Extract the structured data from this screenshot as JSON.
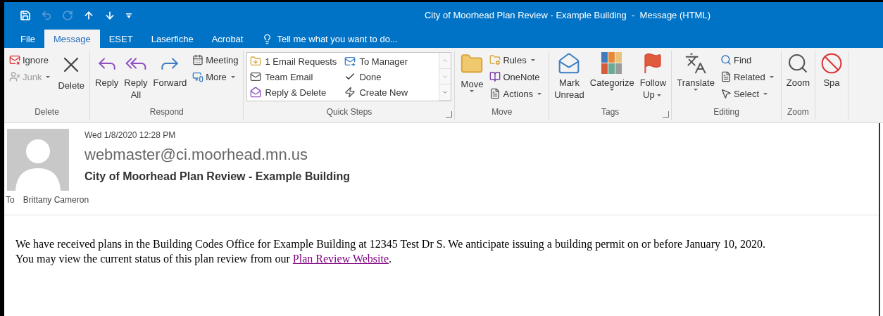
{
  "quick_access": [
    {
      "disabled": false
    },
    {
      "disabled": true
    },
    {
      "disabled": true
    },
    {
      "disabled": false
    },
    {
      "disabled": false
    },
    {
      "disabled": false
    }
  ],
  "window": {
    "title": "City of Moorhead Plan Review - Example Building  -  Message (HTML)"
  },
  "tabs": [
    {
      "label": "File",
      "selected": false
    },
    {
      "label": "Message",
      "selected": true
    },
    {
      "label": "ESET",
      "selected": false
    },
    {
      "label": "Laserfiche",
      "selected": false
    },
    {
      "label": "Acrobat",
      "selected": false
    }
  ],
  "tell_me": {
    "placeholder": "Tell me what you want to do..."
  },
  "ribbon": [
    {
      "label": "Delete",
      "launcher": false,
      "items": [
        {
          "kind": "stack",
          "items": [
            {
              "label": "Ignore",
              "dropdown": false,
              "disabled": false
            },
            {
              "label": "Junk",
              "dropdown": true,
              "disabled": true
            }
          ]
        },
        {
          "kind": "large",
          "label": "Delete",
          "dropdown": false
        }
      ]
    },
    {
      "label": "Respond",
      "launcher": false,
      "items": [
        {
          "kind": "large",
          "label": "Reply",
          "dropdown": false
        },
        {
          "kind": "large",
          "label": "Reply\nAll",
          "dropdown": false
        },
        {
          "kind": "large",
          "label": "Forward",
          "dropdown": false
        },
        {
          "kind": "stack",
          "items": [
            {
              "label": "Meeting",
              "dropdown": false,
              "disabled": false
            },
            {
              "label": "More",
              "dropdown": true,
              "disabled": false
            }
          ]
        }
      ]
    },
    {
      "label": "Quick Steps",
      "launcher": true,
      "items": [
        {
          "kind": "gallery",
          "items": [
            {
              "label": "1 Email Requests"
            },
            {
              "label": "To Manager"
            },
            {
              "label": "Team Email"
            },
            {
              "label": "Done"
            },
            {
              "label": "Reply & Delete"
            },
            {
              "label": "Create New"
            }
          ]
        }
      ]
    },
    {
      "label": "Move",
      "launcher": false,
      "items": [
        {
          "kind": "large",
          "label": "Move",
          "dropdown": true
        },
        {
          "kind": "stack",
          "items": [
            {
              "label": "Rules",
              "dropdown": true,
              "disabled": false
            },
            {
              "label": "OneNote",
              "dropdown": false,
              "disabled": false
            },
            {
              "label": "Actions",
              "dropdown": true,
              "disabled": false
            }
          ]
        }
      ]
    },
    {
      "label": "Tags",
      "launcher": true,
      "items": [
        {
          "kind": "large",
          "label": "Mark\nUnread",
          "dropdown": false
        },
        {
          "kind": "large",
          "label": "Categorize",
          "dropdown": true
        },
        {
          "kind": "large",
          "label": "Follow\nUp",
          "dropdown": true
        }
      ]
    },
    {
      "label": "Editing",
      "launcher": false,
      "items": [
        {
          "kind": "large",
          "label": "Translate",
          "dropdown": true
        },
        {
          "kind": "stack",
          "items": [
            {
              "label": "Find",
              "dropdown": false,
              "disabled": false
            },
            {
              "label": "Related",
              "dropdown": true,
              "disabled": false
            },
            {
              "label": "Select",
              "dropdown": true,
              "disabled": false
            }
          ]
        }
      ]
    },
    {
      "label": "Zoom",
      "launcher": false,
      "items": [
        {
          "kind": "large",
          "label": "Zoom",
          "dropdown": false
        }
      ]
    },
    {
      "launcher": false,
      "items": [
        {
          "kind": "large",
          "label": "Spa",
          "dropdown": false
        }
      ]
    }
  ],
  "message": {
    "date": "Wed 1/8/2020 12:28 PM",
    "sender": "webmaster@ci.moorhead.mn.us",
    "subject": "City of Moorhead Plan Review - Example Building",
    "to_label": "To",
    "to": "Brittany Cameron",
    "body": {
      "lines": [
        "We have received plans in the Building Codes Office for Example Building at 12345 Test Dr S. We anticipate issuing a building permit on or before January 10, 2020.",
        "You may view the current status of this plan review from our "
      ],
      "link": "Plan Review Website",
      "after": "."
    }
  }
}
